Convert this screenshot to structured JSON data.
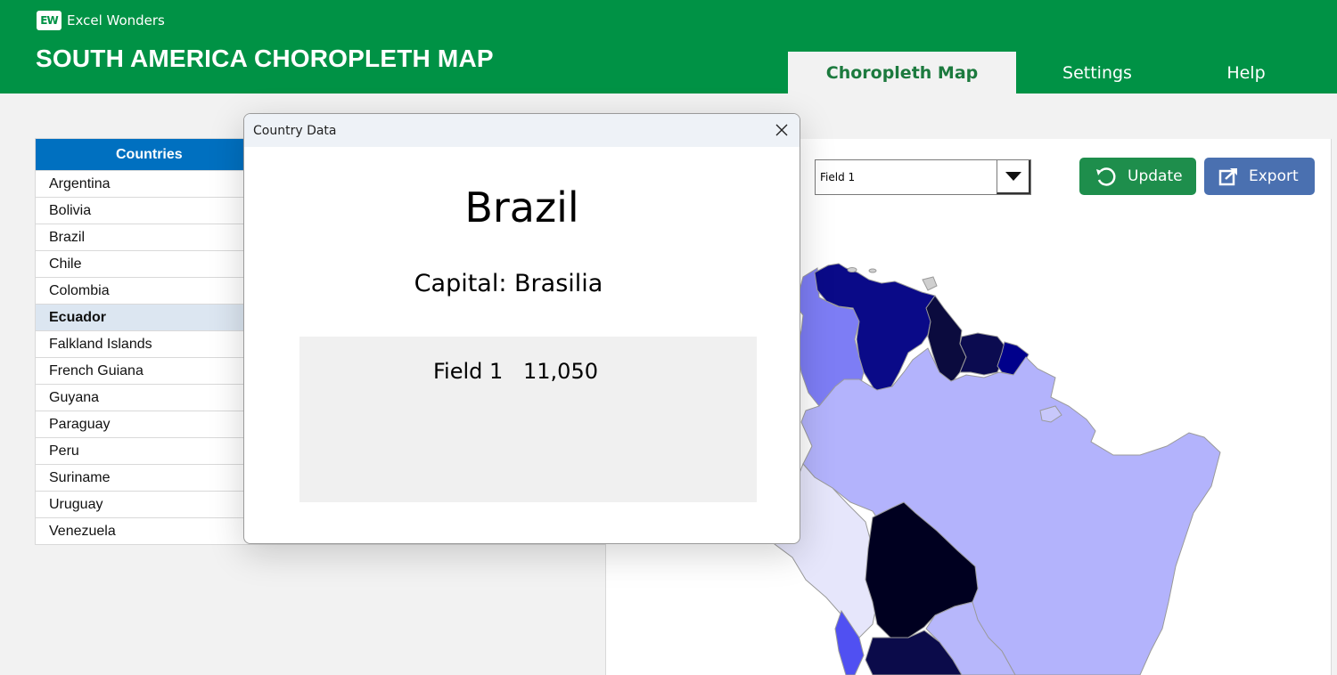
{
  "header": {
    "brand_logo": "EW",
    "brand_name": "Excel Wonders",
    "title": "SOUTH AMERICA CHOROPLETH MAP",
    "tabs": [
      {
        "label": "Choropleth Map",
        "active": true
      },
      {
        "label": "Settings",
        "active": false
      },
      {
        "label": "Help",
        "active": false
      }
    ]
  },
  "countries": {
    "header": "Countries",
    "items": [
      {
        "label": "Argentina"
      },
      {
        "label": "Bolivia"
      },
      {
        "label": "Brazil"
      },
      {
        "label": "Chile"
      },
      {
        "label": "Colombia"
      },
      {
        "label": "Ecuador",
        "selected": true
      },
      {
        "label": "Falkland Islands"
      },
      {
        "label": "French Guiana"
      },
      {
        "label": "Guyana"
      },
      {
        "label": "Paraguay"
      },
      {
        "label": "Peru"
      },
      {
        "label": "Suriname"
      },
      {
        "label": "Uruguay"
      },
      {
        "label": "Venezuela"
      }
    ]
  },
  "controls": {
    "field_select_value": "Field 1",
    "update_label": "Update",
    "export_label": "Export",
    "update_icon": "refresh-icon",
    "export_icon": "share-icon"
  },
  "dialog": {
    "title": "Country Data",
    "country": "Brazil",
    "capital": "Capital: Brasilia",
    "field_label": "Field 1",
    "field_value": "11,050"
  },
  "colors": {
    "header_green": "#009245",
    "list_header_blue": "#0070c0",
    "update_green": "#1e8e4c",
    "export_blue": "#4a70b0"
  }
}
